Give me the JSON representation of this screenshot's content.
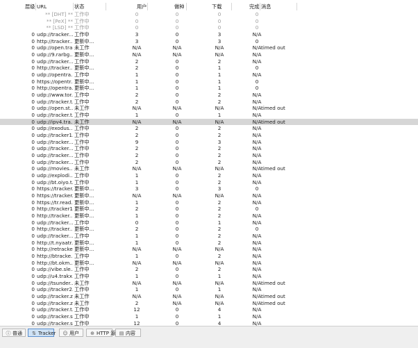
{
  "columns": [
    "层级",
    "URL",
    "状态",
    "用户",
    "做种",
    "下载",
    "完成",
    "消息"
  ],
  "rows": [
    [
      "",
      "** [DHT] **",
      "工作中",
      "0",
      "0",
      "0",
      "0",
      ""
    ],
    [
      "",
      "** [PeX] **",
      "工作中",
      "0",
      "0",
      "0",
      "0",
      ""
    ],
    [
      "",
      "** [LSD] **",
      "工作中",
      "0",
      "0",
      "0",
      "0",
      ""
    ],
    [
      "0",
      "udp://tracker....",
      "工作中",
      "3",
      "0",
      "3",
      "N/A",
      ""
    ],
    [
      "0",
      "http://tracker....",
      "更新中...",
      "3",
      "0",
      "3",
      "0",
      ""
    ],
    [
      "0",
      "udp://open.tra...",
      "未工作",
      "N/A",
      "N/A",
      "N/A",
      "N/A",
      "timed out"
    ],
    [
      "0",
      "udp://9.rarbg....",
      "更新中...",
      "N/A",
      "N/A",
      "N/A",
      "N/A",
      ""
    ],
    [
      "0",
      "udp://tracker....",
      "工作中",
      "2",
      "0",
      "2",
      "N/A",
      ""
    ],
    [
      "0",
      "http://tracker....",
      "更新中...",
      "2",
      "0",
      "1",
      "0",
      ""
    ],
    [
      "0",
      "udp://opentra...",
      "工作中",
      "1",
      "0",
      "1",
      "N/A",
      ""
    ],
    [
      "0",
      "https://opentr...",
      "更新中...",
      "1",
      "0",
      "1",
      "0",
      ""
    ],
    [
      "0",
      "http://opentra...",
      "更新中...",
      "1",
      "0",
      "1",
      "0",
      ""
    ],
    [
      "0",
      "udp://www.tor...",
      "工作中",
      "2",
      "0",
      "2",
      "N/A",
      ""
    ],
    [
      "0",
      "udp://tracker.t...",
      "工作中",
      "2",
      "0",
      "2",
      "N/A",
      ""
    ],
    [
      "0",
      "udp://open.st...",
      "未工作",
      "N/A",
      "N/A",
      "N/A",
      "N/A",
      "timed out"
    ],
    [
      "0",
      "udp://tracker.t...",
      "工作中",
      "1",
      "0",
      "1",
      "N/A",
      ""
    ],
    [
      "0",
      "udp://ipv4.tra...",
      "未工作",
      "N/A",
      "N/A",
      "N/A",
      "N/A",
      "timed out"
    ],
    [
      "0",
      "udp://exodus....",
      "工作中",
      "2",
      "0",
      "2",
      "N/A",
      ""
    ],
    [
      "0",
      "udp://tracker1...",
      "工作中",
      "2",
      "0",
      "2",
      "N/A",
      ""
    ],
    [
      "0",
      "udp://tracker....",
      "工作中",
      "9",
      "0",
      "3",
      "N/A",
      ""
    ],
    [
      "0",
      "udp://tracker....",
      "工作中",
      "2",
      "0",
      "2",
      "N/A",
      ""
    ],
    [
      "0",
      "udp://tracker....",
      "工作中",
      "2",
      "0",
      "2",
      "N/A",
      ""
    ],
    [
      "0",
      "udp://tracker....",
      "工作中",
      "2",
      "0",
      "2",
      "N/A",
      ""
    ],
    [
      "0",
      "udp://movies....",
      "未工作",
      "N/A",
      "N/A",
      "N/A",
      "N/A",
      "timed out"
    ],
    [
      "0",
      "udp://explodi...",
      "工作中",
      "1",
      "0",
      "2",
      "N/A",
      ""
    ],
    [
      "0",
      "udp://bt.oiyo.t...",
      "工作中",
      "1",
      "0",
      "2",
      "N/A",
      ""
    ],
    [
      "0",
      "https://tracker...",
      "更新中...",
      "3",
      "0",
      "3",
      "0",
      ""
    ],
    [
      "0",
      "https://tracker...",
      "更新中...",
      "N/A",
      "N/A",
      "N/A",
      "N/A",
      ""
    ],
    [
      "0",
      "https://tr.read...",
      "更新中...",
      "1",
      "0",
      "2",
      "N/A",
      ""
    ],
    [
      "0",
      "http://tracker1...",
      "更新中...",
      "2",
      "0",
      "2",
      "0",
      ""
    ],
    [
      "0",
      "http://tracker....",
      "更新中...",
      "1",
      "0",
      "2",
      "N/A",
      ""
    ],
    [
      "0",
      "udp://tracker....",
      "工作中",
      "0",
      "0",
      "1",
      "N/A",
      ""
    ],
    [
      "0",
      "http://tracker....",
      "更新中...",
      "2",
      "0",
      "2",
      "0",
      ""
    ],
    [
      "0",
      "udp://tracker....",
      "工作中",
      "1",
      "0",
      "2",
      "N/A",
      ""
    ],
    [
      "0",
      "http://t.nyaatr...",
      "更新中...",
      "1",
      "0",
      "2",
      "N/A",
      ""
    ],
    [
      "0",
      "http://retracke...",
      "更新中...",
      "N/A",
      "N/A",
      "N/A",
      "N/A",
      ""
    ],
    [
      "0",
      "http://btracke...",
      "工作中",
      "1",
      "0",
      "2",
      "N/A",
      ""
    ],
    [
      "0",
      "http://bt.okm....",
      "更新中...",
      "N/A",
      "N/A",
      "N/A",
      "N/A",
      ""
    ],
    [
      "0",
      "udp://vibe.sle...",
      "工作中",
      "2",
      "0",
      "2",
      "N/A",
      ""
    ],
    [
      "0",
      "udp://u4.trakx....",
      "工作中",
      "1",
      "0",
      "1",
      "N/A",
      ""
    ],
    [
      "0",
      "udp://tsunder...",
      "未工作",
      "N/A",
      "N/A",
      "N/A",
      "N/A",
      "timed out"
    ],
    [
      "0",
      "udp://tracker2....",
      "工作中",
      "1",
      "0",
      "1",
      "N/A",
      ""
    ],
    [
      "0",
      "udp://tracker.z...",
      "未工作",
      "N/A",
      "N/A",
      "N/A",
      "N/A",
      "timed out"
    ],
    [
      "0",
      "udp://tracker.z...",
      "未工作",
      "2",
      "N/A",
      "N/A",
      "N/A",
      "timed out"
    ],
    [
      "0",
      "udp://tracker.t...",
      "工作中",
      "12",
      "0",
      "4",
      "N/A",
      ""
    ],
    [
      "0",
      "udp://tracker.s...",
      "工作中",
      "1",
      "0",
      "1",
      "N/A",
      ""
    ],
    [
      "0",
      "udp://tracker.s...",
      "工作中",
      "12",
      "0",
      "4",
      "N/A",
      ""
    ]
  ],
  "selected_row": 16,
  "tabs": [
    {
      "label": "普通",
      "icon": "info-icon"
    },
    {
      "label": "Tracker",
      "icon": "tracker-icon",
      "active": true
    },
    {
      "label": "用户",
      "icon": "users-icon"
    },
    {
      "label": "HTTP 源",
      "icon": "http-source-icon"
    },
    {
      "label": "内容",
      "icon": "content-icon"
    }
  ]
}
